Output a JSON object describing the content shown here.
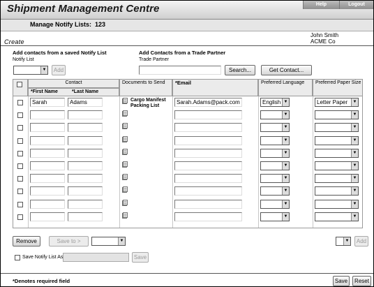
{
  "header": {
    "app_title": "Shipment Management Centre",
    "help_label": "Help",
    "logout_label": "Logout",
    "subtitle": "Manage Notify Lists:",
    "list_id": "123"
  },
  "page": {
    "mode_label": "Create"
  },
  "user": {
    "name": "John Smith",
    "company": "ACME Co"
  },
  "saved_list": {
    "heading": "Add contacts from a saved Notify List",
    "field_label": "Notify List",
    "select_value": "",
    "add_label": "Add"
  },
  "trade_partner": {
    "heading": "Add Contacts from a Trade Partner",
    "field_label": "Trade Partner",
    "value": "",
    "search_label": "Search...",
    "get_contact_label": "Get Contact..."
  },
  "table": {
    "headers": {
      "contact": "Contact",
      "first_name": "*First Name",
      "last_name": "*Last Name",
      "documents": "Documents to Send",
      "email": "*Email",
      "language": "Preferred Language",
      "paper": "Preferred Paper Size"
    },
    "rows": [
      {
        "first": "Sarah",
        "last": "Adams",
        "docs": [
          "Cargo Manifest",
          "Packing List"
        ],
        "email": "Sarah.Adams@pack.com",
        "language": "English",
        "paper": "Letter Paper"
      },
      {
        "first": "",
        "last": "",
        "docs": [],
        "email": "",
        "language": "",
        "paper": ""
      },
      {
        "first": "",
        "last": "",
        "docs": [],
        "email": "",
        "language": "",
        "paper": ""
      },
      {
        "first": "",
        "last": "",
        "docs": [],
        "email": "",
        "language": "",
        "paper": ""
      },
      {
        "first": "",
        "last": "",
        "docs": [],
        "email": "",
        "language": "",
        "paper": ""
      },
      {
        "first": "",
        "last": "",
        "docs": [],
        "email": "",
        "language": "",
        "paper": ""
      },
      {
        "first": "",
        "last": "",
        "docs": [],
        "email": "",
        "language": "",
        "paper": ""
      },
      {
        "first": "",
        "last": "",
        "docs": [],
        "email": "",
        "language": "",
        "paper": ""
      },
      {
        "first": "",
        "last": "",
        "docs": [],
        "email": "",
        "language": "",
        "paper": ""
      },
      {
        "first": "",
        "last": "",
        "docs": [],
        "email": "",
        "language": "",
        "paper": ""
      }
    ]
  },
  "actions": {
    "remove_label": "Remove",
    "save_to_label": "Save to >",
    "save_to_value": "",
    "right_select_value": "",
    "right_add_label": "Add"
  },
  "save_list": {
    "checkbox_label": "Save Notify List As",
    "name_value": "",
    "save_label": "Save"
  },
  "footer": {
    "required_note": "*Denotes required field",
    "save_label": "Save",
    "reset_label": "Reset"
  },
  "icons": {
    "document": "document-icon",
    "dropdown": "chevron-down-icon",
    "checkbox": "checkbox"
  }
}
